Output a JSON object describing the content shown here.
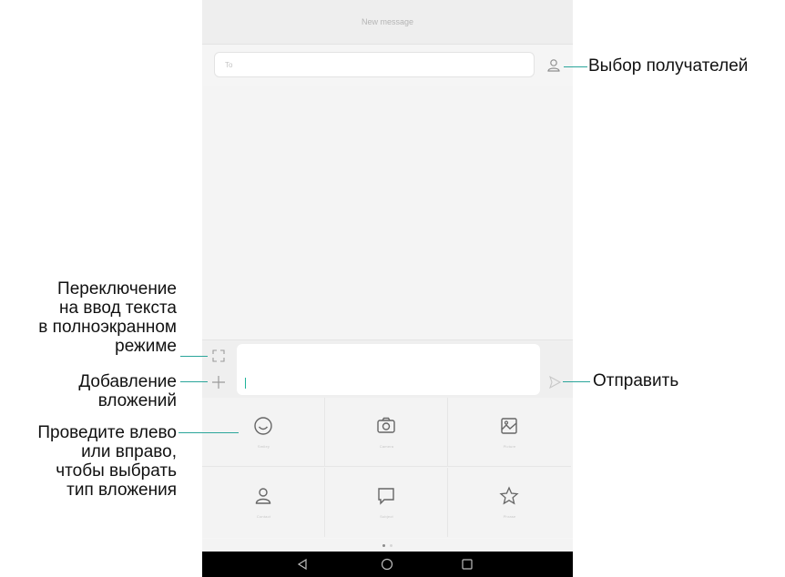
{
  "app": {
    "title": "New message"
  },
  "recipient": {
    "placeholder": "To"
  },
  "compose": {
    "value": ""
  },
  "attachments": [
    {
      "label": "Smiley",
      "icon": "smiley-icon"
    },
    {
      "label": "Camera",
      "icon": "camera-icon"
    },
    {
      "label": "Picture",
      "icon": "picture-icon"
    },
    {
      "label": "Contact",
      "icon": "contact-icon"
    },
    {
      "label": "Subject",
      "icon": "subject-icon"
    },
    {
      "label": "Phrase",
      "icon": "star-icon"
    }
  ],
  "pager": {
    "pages": 2,
    "current": 1
  },
  "navbar": [
    "back-icon",
    "home-icon",
    "recents-icon"
  ],
  "callouts": {
    "select_recipients": "Выбор получателей",
    "fullscreen_lines": [
      "Переключение",
      "на ввод текста",
      "в полноэкранном",
      "режиме"
    ],
    "attachments_lines": [
      "Добавление",
      "вложений"
    ],
    "send": "Отправить",
    "swipe_lines": [
      "Проведите влево",
      "или вправо,",
      "чтобы выбрать",
      "тип вложения"
    ]
  },
  "colors": {
    "accent": "#1fb39a",
    "leader": "#2aa59a",
    "navbar": "#000000",
    "icon": "#666666"
  }
}
